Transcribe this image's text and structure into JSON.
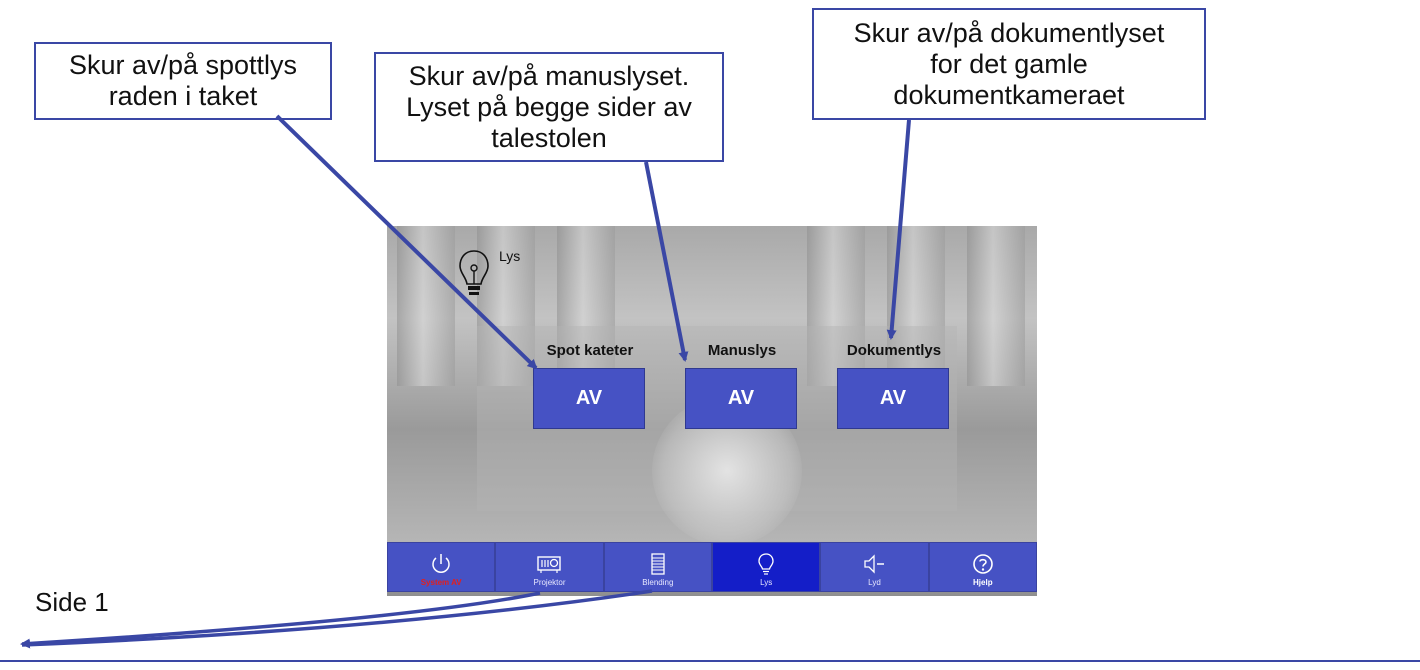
{
  "callouts": {
    "spot": "Skur av/på spottlys\nraden i taket",
    "manus": "Skur av/på manuslyset.\nLyset på begge sider av\ntalestolen",
    "dokument": "Skur av/på dokumentlyset\nfor det gamle\ndokumentkameraet"
  },
  "panel": {
    "title": "Lys",
    "controls": [
      {
        "label": "Spot kateter",
        "state": "AV"
      },
      {
        "label": "Manuslys",
        "state": "AV"
      },
      {
        "label": "Dokumentlys",
        "state": "AV"
      }
    ],
    "nav": [
      {
        "label": "System AV",
        "icon": "power-icon"
      },
      {
        "label": "Projektor",
        "icon": "projector-icon"
      },
      {
        "label": "Blending",
        "icon": "blinds-icon"
      },
      {
        "label": "Lys",
        "icon": "bulb-icon",
        "active": true
      },
      {
        "label": "Lyd",
        "icon": "speaker-icon"
      },
      {
        "label": "Hjelp",
        "icon": "help-icon"
      }
    ]
  },
  "side_label": "Side 1",
  "colors": {
    "accent": "#4652c4",
    "active_tab": "#141ec8",
    "arrow": "#3a47a5",
    "power_label": "#e02020"
  }
}
